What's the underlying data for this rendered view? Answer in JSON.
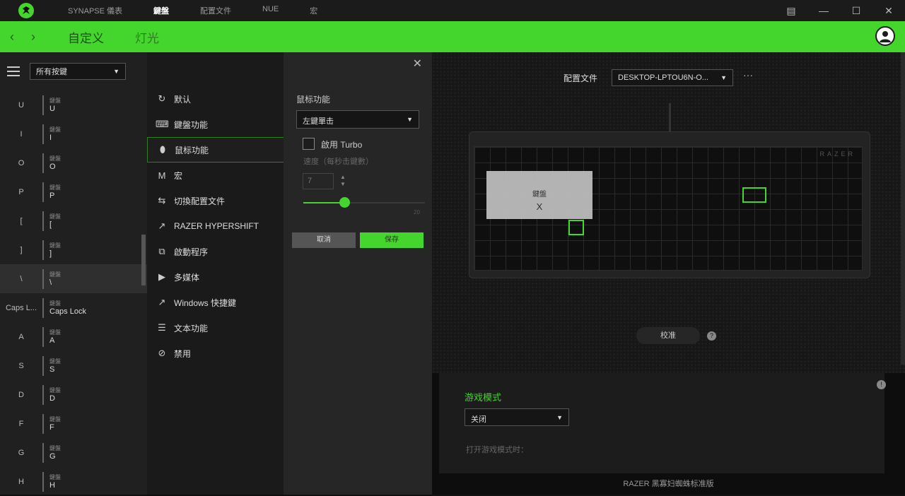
{
  "titlebar": {
    "tabs": [
      {
        "label": "SYNAPSE 儀表"
      },
      {
        "label": "鍵盤"
      },
      {
        "label": "配置文件"
      },
      {
        "label": "NUE"
      },
      {
        "label": "宏"
      }
    ],
    "minimize": "—",
    "maximize": "☐",
    "close": "✕"
  },
  "header": {
    "back": "‹",
    "forward": "›",
    "tab_customize": "自定义",
    "tab_lighting": "灯光"
  },
  "keylist": {
    "filter": "所有按鍵",
    "items": [
      {
        "key": "U",
        "sub": "鍵盤",
        "value": "U"
      },
      {
        "key": "I",
        "sub": "鍵盤",
        "value": "I"
      },
      {
        "key": "O",
        "sub": "鍵盤",
        "value": "O"
      },
      {
        "key": "P",
        "sub": "鍵盤",
        "value": "P"
      },
      {
        "key": "[",
        "sub": "鍵盤",
        "value": "["
      },
      {
        "key": "]",
        "sub": "鍵盤",
        "value": "]"
      },
      {
        "key": "\\",
        "sub": "鍵盤",
        "value": "\\"
      },
      {
        "key": "Caps L...",
        "sub": "鍵盤",
        "value": "Caps Lock"
      },
      {
        "key": "A",
        "sub": "鍵盤",
        "value": "A"
      },
      {
        "key": "S",
        "sub": "鍵盤",
        "value": "S"
      },
      {
        "key": "D",
        "sub": "鍵盤",
        "value": "D"
      },
      {
        "key": "F",
        "sub": "鍵盤",
        "value": "F"
      },
      {
        "key": "G",
        "sub": "鍵盤",
        "value": "G"
      },
      {
        "key": "H",
        "sub": "鍵盤",
        "value": "H"
      }
    ]
  },
  "functions": {
    "items": [
      {
        "icon": "↻",
        "label": "默认"
      },
      {
        "icon": "⌨",
        "label": "鍵盤功能"
      },
      {
        "icon": "⬮",
        "label": "鼠标功能"
      },
      {
        "icon": "M",
        "label": "宏"
      },
      {
        "icon": "⇆",
        "label": "切換配置文件"
      },
      {
        "icon": "↗",
        "label": "RAZER HYPERSHIFT"
      },
      {
        "icon": "⧉",
        "label": "啟動程序"
      },
      {
        "icon": "▶",
        "label": "多媒体"
      },
      {
        "icon": "↗",
        "label": "Windows 快捷鍵"
      },
      {
        "icon": "☰",
        "label": "文本功能"
      },
      {
        "icon": "⊘",
        "label": "禁用"
      }
    ]
  },
  "panel": {
    "close": "✕",
    "title": "鼠标功能",
    "select_value": "左鍵單击",
    "turbo_label": "啟用 Turbo",
    "speed_label": "速度（每秒击鍵數）",
    "speed_value": "7",
    "speed_fraction": 0.34,
    "slider_max": "20",
    "cancel": "取消",
    "save": "保存"
  },
  "preview": {
    "profile_label": "配置文件",
    "profile_value": "DESKTOP-LPTOU6N-O...",
    "more": "···",
    "keyboard_brand": "RAZER",
    "tooltip_title": "鍵盤",
    "tooltip_value": "X",
    "calibrate": "校准",
    "info": "?"
  },
  "game_mode": {
    "title": "游戏模式",
    "value": "关闭",
    "note": "打开游戏模式时：",
    "info": "!"
  },
  "status": {
    "text": "RAZER 黑寡妇蜘蛛标准版"
  },
  "colors": {
    "accent": "#44d62c"
  }
}
